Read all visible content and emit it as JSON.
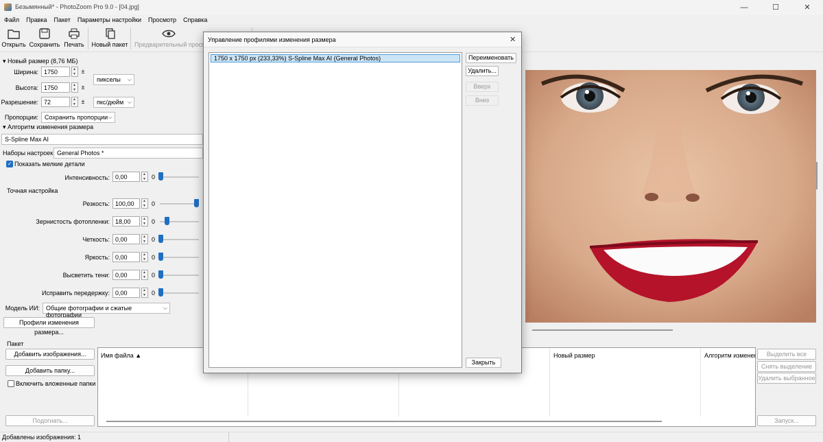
{
  "window": {
    "title": "Безымянный* - PhotoZoom Pro 9.0 - [04.jpg]",
    "minimize": "—",
    "maximize": "☐",
    "close": "✕"
  },
  "menu": [
    "Файл",
    "Правка",
    "Пакет",
    "Параметры настройки",
    "Просмотр",
    "Справка"
  ],
  "toolbar": {
    "open": "Открыть",
    "save": "Сохранить",
    "print": "Печать",
    "batch": "Новый пакет",
    "preview": "Предварительный просм"
  },
  "size": {
    "section": "Новый размер (8,76 МБ)",
    "width_label": "Ширина:",
    "width": "1750",
    "height_label": "Высота:",
    "height": "1750",
    "unit": "пикселы",
    "res_label": "Разрешение:",
    "res": "72",
    "res_unit": "пкс/дюйм",
    "prop_label": "Пропорции:",
    "prop": "Сохранить пропорции"
  },
  "algo": {
    "section": "Алгоритм изменения размера",
    "method": "S-Spline Max AI",
    "presets_label": "Наборы настроек:",
    "preset": "General Photos *"
  },
  "details": {
    "label": "Показать мелкие детали",
    "intensity_label": "Интенсивность:",
    "intensity": "0,00",
    "intensity_zero": "0"
  },
  "fine": {
    "section": "Точная настройка",
    "rows": [
      {
        "label": "Резкость:",
        "value": "100,00",
        "zero": "0",
        "level": 1.0
      },
      {
        "label": "Зернистость фотопленки:",
        "value": "18,00",
        "zero": "0",
        "level": 0.18
      },
      {
        "label": "Четкость:",
        "value": "0,00",
        "zero": "0",
        "level": 0
      },
      {
        "label": "Яркость:",
        "value": "0,00",
        "zero": "0",
        "level": 0
      },
      {
        "label": "Высветить тени:",
        "value": "0,00",
        "zero": "0",
        "level": 0
      },
      {
        "label": "Исправить передержку:",
        "value": "0,00",
        "zero": "0",
        "level": 0
      }
    ]
  },
  "ai": {
    "label": "Модель ИИ:",
    "value": "Общие фотографии и сжатые фотографии"
  },
  "profiles_button": "Профили изменения размера...",
  "batch": {
    "section": "Пакет",
    "add_images": "Добавить изображения...",
    "add_folder": "Добавить папку...",
    "include_sub": "Включить вложенные папки",
    "fit": "Подогнать...",
    "columns": [
      "Имя файла ▲",
      "",
      "",
      "Новый размер",
      "Алгоритм изменен"
    ],
    "select_all": "Выделить все",
    "deselect": "Снять выделение",
    "delete_sel": "Удалить выбранное",
    "run": "Запуск..."
  },
  "status": "Добавлены изображения: 1",
  "dialog": {
    "title": "Управление профилями изменения размера",
    "item": "1750 x 1750 px (233,33%) S-Spline Max AI (General Photos)",
    "rename": "Переименовать",
    "delete": "Удалить...",
    "up": "Вверх",
    "down": "Вниз",
    "close_btn": "Закрыть",
    "close_x": "✕"
  }
}
